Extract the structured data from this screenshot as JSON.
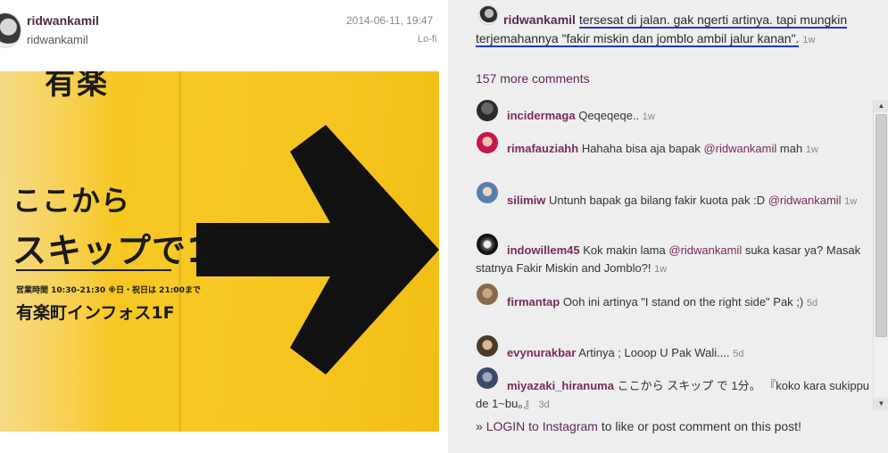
{
  "post": {
    "username": "ridwankamil",
    "username_secondary": "ridwankamil",
    "timestamp": "2014-06-11, 19:47",
    "filter": "Lo-fi",
    "photo_text": {
      "top": "有楽",
      "line1": "ここから",
      "line2": "スキップで1分",
      "hours": "営業時間 10:30-21:30 ※日・祝日は 21:00まで",
      "store": "有楽町インフォス1F"
    }
  },
  "caption": {
    "username": "ridwankamil",
    "text": "tersesat di jalan. gak ngerti artinya. tapi mungkin terjemahannya \"fakir miskin dan jomblo ambil jalur kanan\".",
    "age": "1w"
  },
  "more_comments": "157 more comments",
  "comments": [
    {
      "username": "incidermaga",
      "text": "Qeqeqeqe..",
      "age": "1w",
      "avatar_color": "#2b2b2b"
    },
    {
      "username": "rimafauziahh",
      "text": "Hahaha bisa aja bapak",
      "mention": "@ridwankamil",
      "text_after": "mah",
      "age": "1w",
      "avatar_color": "#c2184a"
    },
    {
      "username": "silimiw",
      "text": "Untunh bapak ga bilang fakir kuota pak :D",
      "mention": "@ridwankamil",
      "text_after": "",
      "age": "1w",
      "avatar_color": "#5a7fa8"
    },
    {
      "username": "indowillem45",
      "text": "Kok makin lama",
      "mention": "@ridwankamil",
      "text_after": "suka kasar ya? Masak statnya Fakir Miskin and Jomblo?!",
      "age": "1w",
      "avatar_color": "#111111"
    },
    {
      "username": "firmantap",
      "text": "Ooh ini artinya \"I stand on the right side\" Pak ;)",
      "age": "5d",
      "avatar_color": "#8a6a4a"
    },
    {
      "username": "evynurakbar",
      "text": "Artinya ; Looop U Pak Wali....",
      "age": "5d",
      "avatar_color": "#4a3a2a"
    },
    {
      "username": "miyazaki_hiranuma",
      "text": "ここから スキップ で 1分。 『koko kara sukippu de 1~bu。』",
      "age": "3d",
      "avatar_color": "#3a4a6a"
    }
  ],
  "login": {
    "prefix": "»",
    "link": "LOGIN to Instagram",
    "suffix": "to like or post comment on this post!"
  },
  "scrollbar": {
    "up": "▲",
    "down": "▼"
  }
}
